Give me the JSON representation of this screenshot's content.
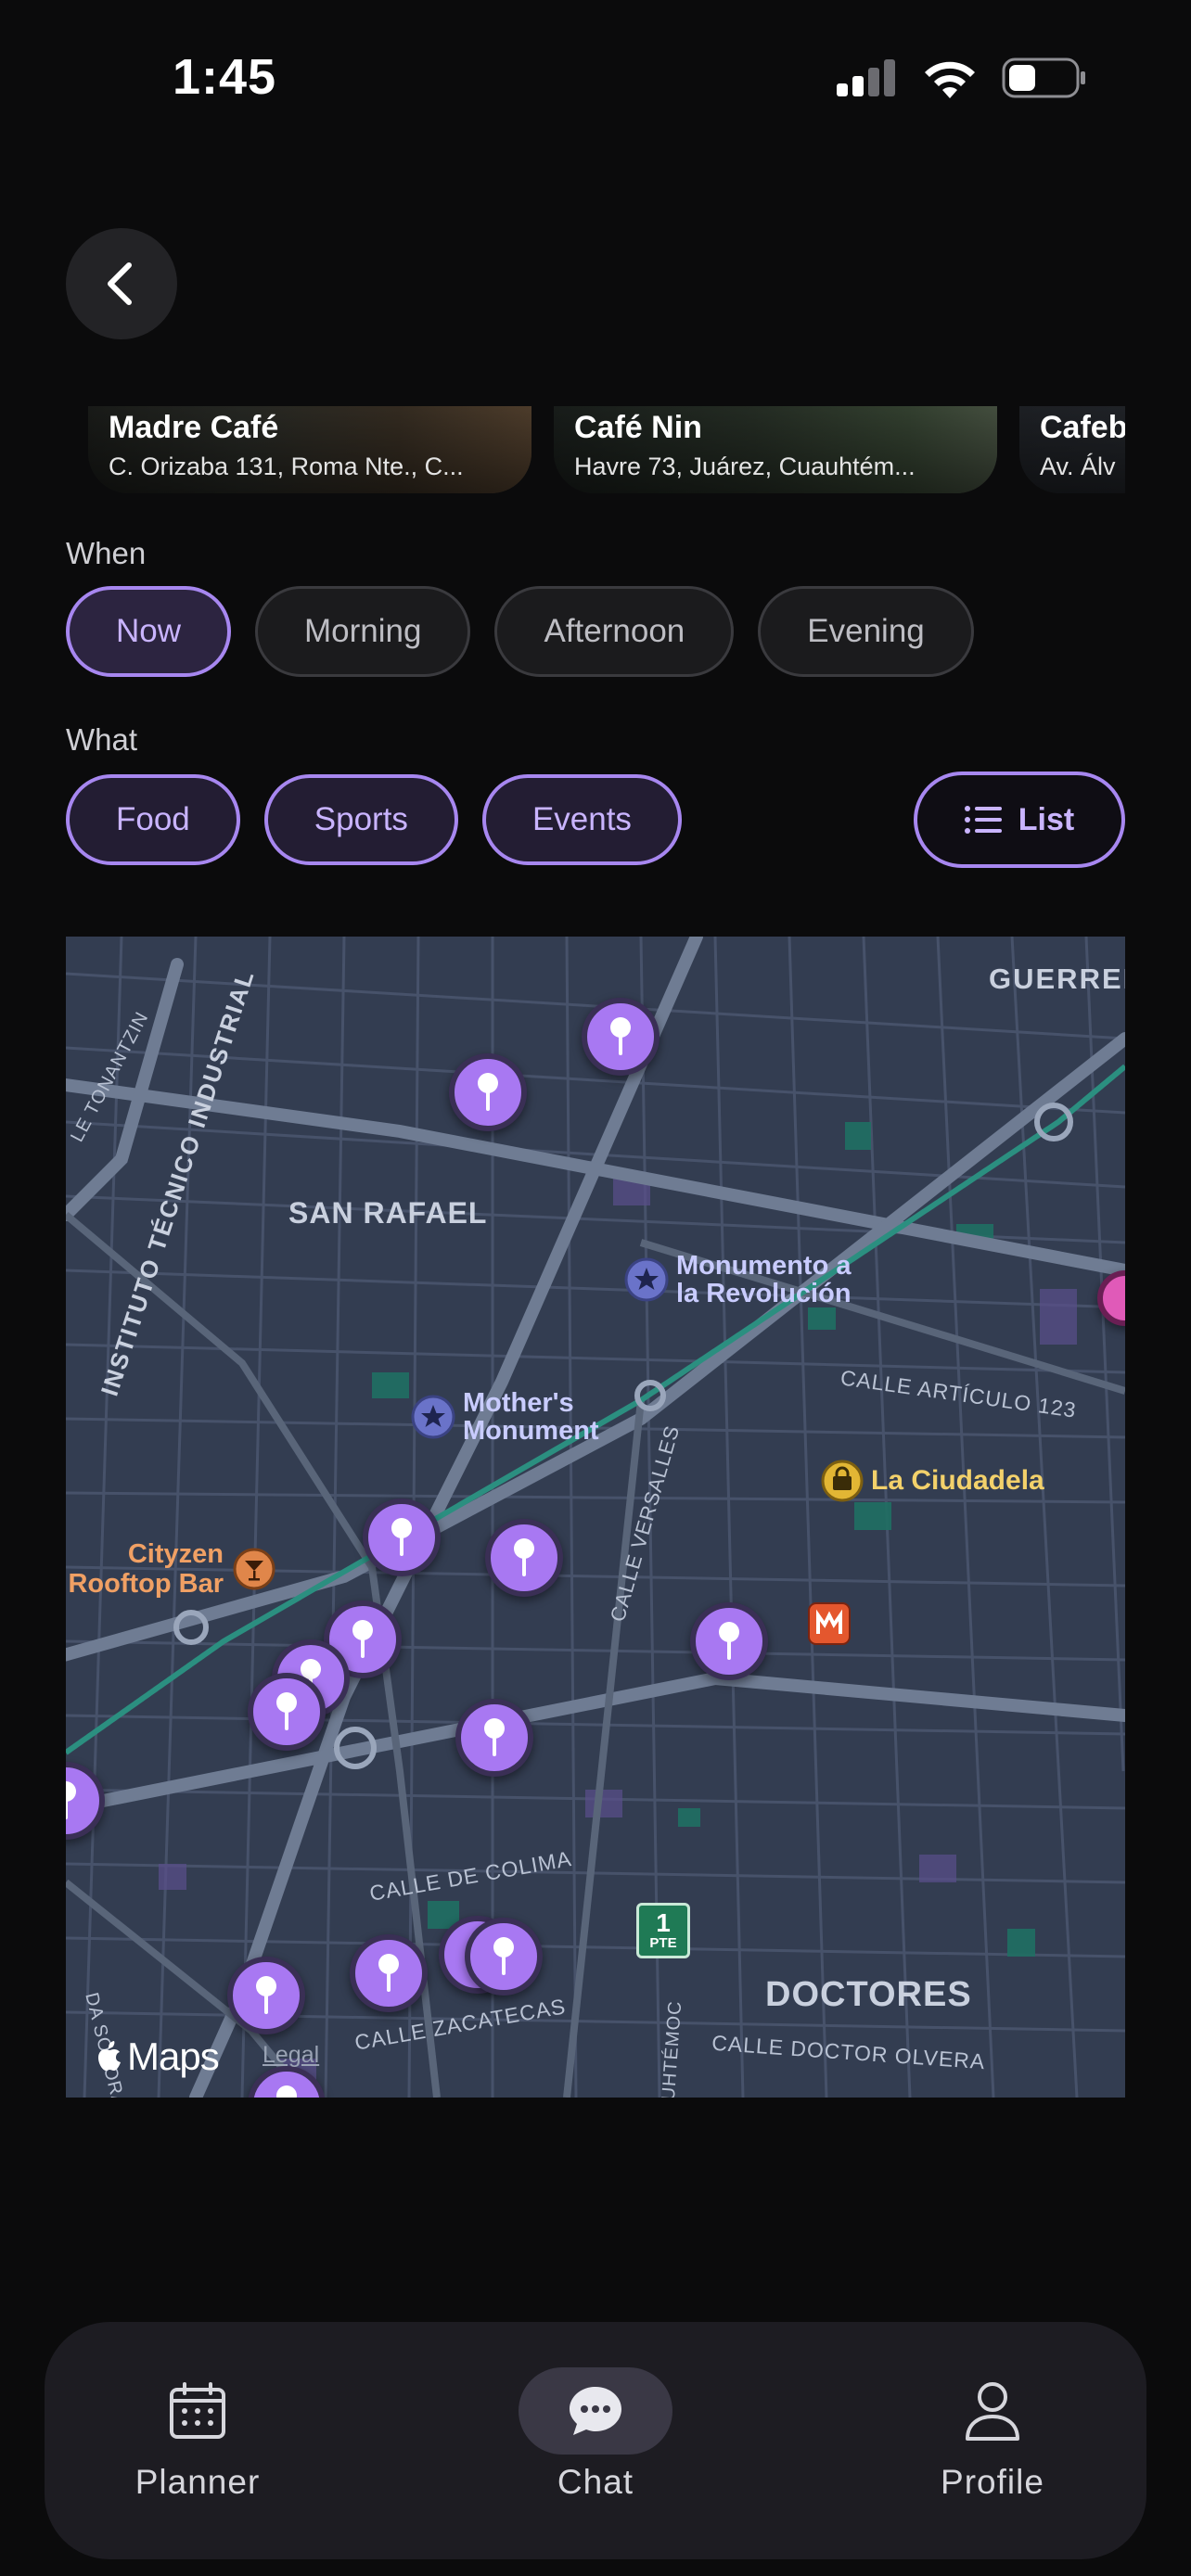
{
  "status_bar": {
    "time": "1:45"
  },
  "places": [
    {
      "name": "Madre Café",
      "address": "C. Orizaba 131, Roma Nte., C..."
    },
    {
      "name": "Café Nin",
      "address": "Havre 73, Juárez, Cuauhtém..."
    },
    {
      "name": "Cafeb",
      "address": "Av. Álv"
    }
  ],
  "when": {
    "label": "When",
    "options": [
      "Now",
      "Morning",
      "Afternoon",
      "Evening"
    ],
    "selected": "Now"
  },
  "what": {
    "label": "What",
    "options": [
      "Food",
      "Sports",
      "Events"
    ]
  },
  "list_button": {
    "label": "List"
  },
  "map": {
    "neighborhoods": [
      "GUERRERO",
      "SAN RAFAEL",
      "DOCTORES"
    ],
    "streets": [
      "CALLE ARTÍCULO 123",
      "CALLE VERSALLES",
      "CALLE DE COLIMA",
      "CALLE ZACATECAS",
      "CALLE DOCTOR OLVERA",
      "INSTITUTO TÉCNICO INDUSTRIAL",
      "LE TONANTZIN",
      "DA SONORA",
      "UHTÉMOC"
    ],
    "landmarks": [
      "Monumento a la Revolución",
      "Mother's Monument",
      "La Ciudadela",
      "Cityzen Rooftop Bar"
    ],
    "route_badge": {
      "number": "1",
      "text": "PTE"
    },
    "attribution": "Maps",
    "legal": "Legal"
  },
  "tabs": [
    {
      "label": "Planner",
      "icon": "calendar-icon"
    },
    {
      "label": "Chat",
      "icon": "chat-bubble-icon",
      "active": true
    },
    {
      "label": "Profile",
      "icon": "person-icon"
    }
  ],
  "colors": {
    "accent": "#a787f0",
    "pin": "#a878f2",
    "background": "#0b0b0c",
    "map": "#323c4f"
  }
}
